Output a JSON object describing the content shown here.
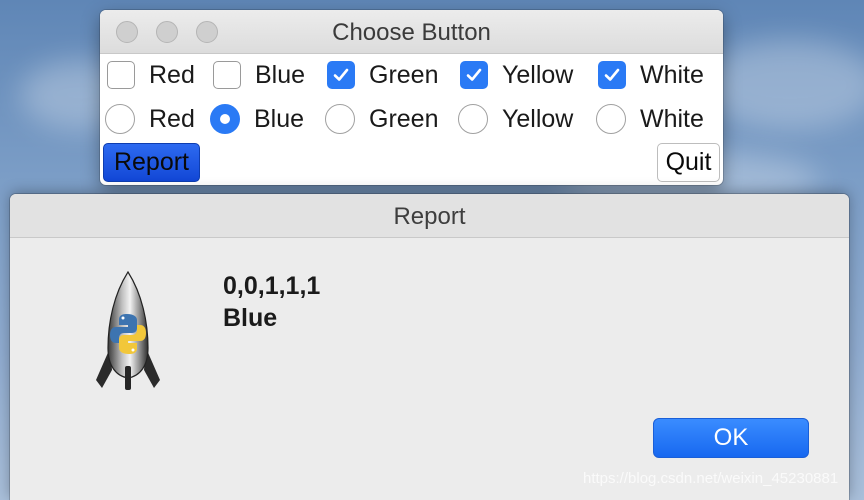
{
  "main_window": {
    "title": "Choose Button",
    "checkboxes": [
      {
        "label": "Red",
        "checked": false
      },
      {
        "label": "Blue",
        "checked": false
      },
      {
        "label": "Green",
        "checked": true
      },
      {
        "label": "Yellow",
        "checked": true
      },
      {
        "label": "White",
        "checked": true
      }
    ],
    "radios": [
      {
        "label": "Red",
        "selected": false
      },
      {
        "label": "Blue",
        "selected": true
      },
      {
        "label": "Green",
        "selected": false
      },
      {
        "label": "Yellow",
        "selected": false
      },
      {
        "label": "White",
        "selected": false
      }
    ],
    "report_button": "Report",
    "quit_button": "Quit"
  },
  "report_dialog": {
    "title": "Report",
    "line1": "0,0,1,1,1",
    "line2": "Blue",
    "ok_button": "OK",
    "icon": "python-rocket-icon"
  },
  "watermark": "https://blog.csdn.net/weixin_45230881",
  "colors": {
    "accent": "#2a7af5",
    "report_button": "#1a55e0",
    "ok_button": "#2077fb"
  }
}
